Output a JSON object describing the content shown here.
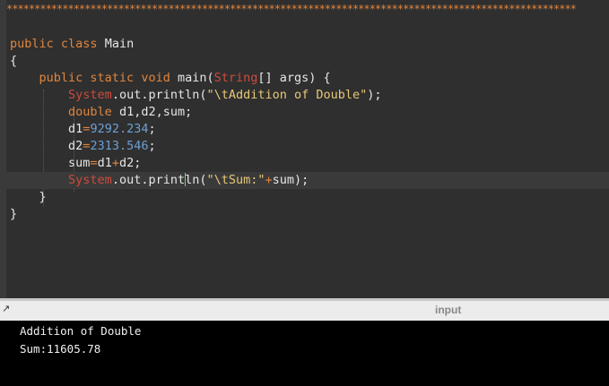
{
  "editor": {
    "header_stars": "******************************************************************************************************",
    "lines": [
      {
        "indent": "",
        "tokens": [
          [
            "kw",
            "public "
          ],
          [
            "kw",
            "class "
          ],
          [
            "cls",
            "Main"
          ]
        ]
      },
      {
        "indent": "",
        "tokens": [
          [
            "cls",
            "{"
          ]
        ]
      },
      {
        "indent": "    ",
        "tokens": [
          [
            "kw",
            "public "
          ],
          [
            "kw",
            "static "
          ],
          [
            "kw",
            "void "
          ],
          [
            "cls",
            "main("
          ],
          [
            "type",
            "String"
          ],
          [
            "cls",
            "[] args) {"
          ]
        ]
      },
      {
        "indent": "        ",
        "tokens": [
          [
            "type",
            "System"
          ],
          [
            "cls",
            ".out.println("
          ],
          [
            "str",
            "\"\\tAddition of Double\""
          ],
          [
            "cls",
            ");"
          ]
        ]
      },
      {
        "indent": "        ",
        "tokens": [
          [
            "kw",
            "double "
          ],
          [
            "cls",
            "d1,d2,sum;"
          ]
        ]
      },
      {
        "indent": "        ",
        "tokens": [
          [
            "cls",
            "d1"
          ],
          [
            "op",
            "="
          ],
          [
            "num",
            "9292.234"
          ],
          [
            "cls",
            ";"
          ]
        ]
      },
      {
        "indent": "        ",
        "tokens": [
          [
            "cls",
            "d2"
          ],
          [
            "op",
            "="
          ],
          [
            "num",
            "2313.546"
          ],
          [
            "cls",
            ";"
          ]
        ]
      },
      {
        "indent": "        ",
        "tokens": [
          [
            "cls",
            "sum"
          ],
          [
            "op",
            "="
          ],
          [
            "cls",
            "d1"
          ],
          [
            "op",
            "+"
          ],
          [
            "cls",
            "d2;"
          ]
        ]
      },
      {
        "indent": "        ",
        "tokens": [
          [
            "type",
            "System"
          ],
          [
            "cls",
            ".out.print"
          ],
          [
            "cursor",
            ""
          ],
          [
            "cls",
            "ln("
          ],
          [
            "str",
            "\"\\tSum:\""
          ],
          [
            "op",
            "+"
          ],
          [
            "cls",
            "sum);"
          ]
        ],
        "highlight": true
      },
      {
        "indent": "    ",
        "tokens": [
          [
            "cls",
            "}"
          ]
        ]
      },
      {
        "indent": "",
        "tokens": [
          [
            "cls",
            "}"
          ]
        ]
      }
    ]
  },
  "panel": {
    "tab_label": "input",
    "resize_icon": "↗"
  },
  "console": {
    "output": "Addition of Double\nSum:11605.78"
  }
}
